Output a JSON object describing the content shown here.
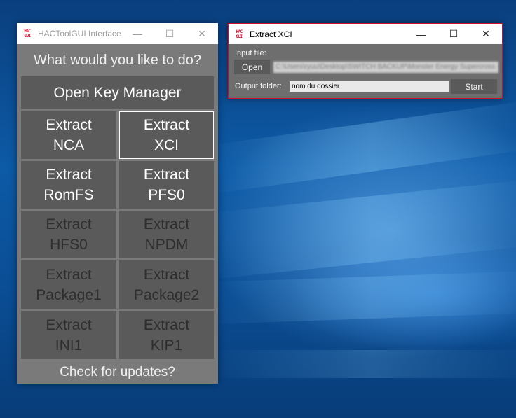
{
  "main_window": {
    "app_icon": "HAC\nGUI",
    "title": "HACToolGUI Interface",
    "controls": {
      "minimize": "—",
      "maximize": "☐",
      "close": "✕"
    },
    "question": "What would you like to do?",
    "buttons": {
      "open_key_manager": "Open Key Manager",
      "extract_nca": "Extract\nNCA",
      "extract_xci": "Extract\nXCI",
      "extract_romfs": "Extract\nRomFS",
      "extract_pfs0": "Extract\nPFS0",
      "extract_hfs0": "Extract\nHFS0",
      "extract_npdm": "Extract\nNPDM",
      "extract_package1": "Extract\nPackage1",
      "extract_package2": "Extract\nPackage2",
      "extract_ini1": "Extract\nINI1",
      "extract_kip1": "Extract\nKIP1"
    },
    "check_updates": "Check for updates?"
  },
  "xci_window": {
    "app_icon": "HAC\nGUI",
    "title": "Extract XCI",
    "controls": {
      "minimize": "—",
      "maximize": "☐",
      "close": "✕"
    },
    "input_file_label": "Input file:",
    "open_button": "Open",
    "input_path": "C:\\Users\\ryuu\\Desktop\\SWITCH BACKUP\\Monster Energy Supercross - ",
    "output_folder_label": "Output folder:",
    "output_folder_value": "nom du dossier",
    "start_button": "Start"
  },
  "colors": {
    "window_bg": "#7a7a7a",
    "button_bg": "#5a5a5a",
    "accent_border": "#c8102e",
    "desktop_bg": "#0a4a8c"
  },
  "icons": {
    "app": "hac-gui-icon",
    "minimize": "minimize-icon",
    "maximize": "maximize-icon",
    "close": "close-icon"
  }
}
